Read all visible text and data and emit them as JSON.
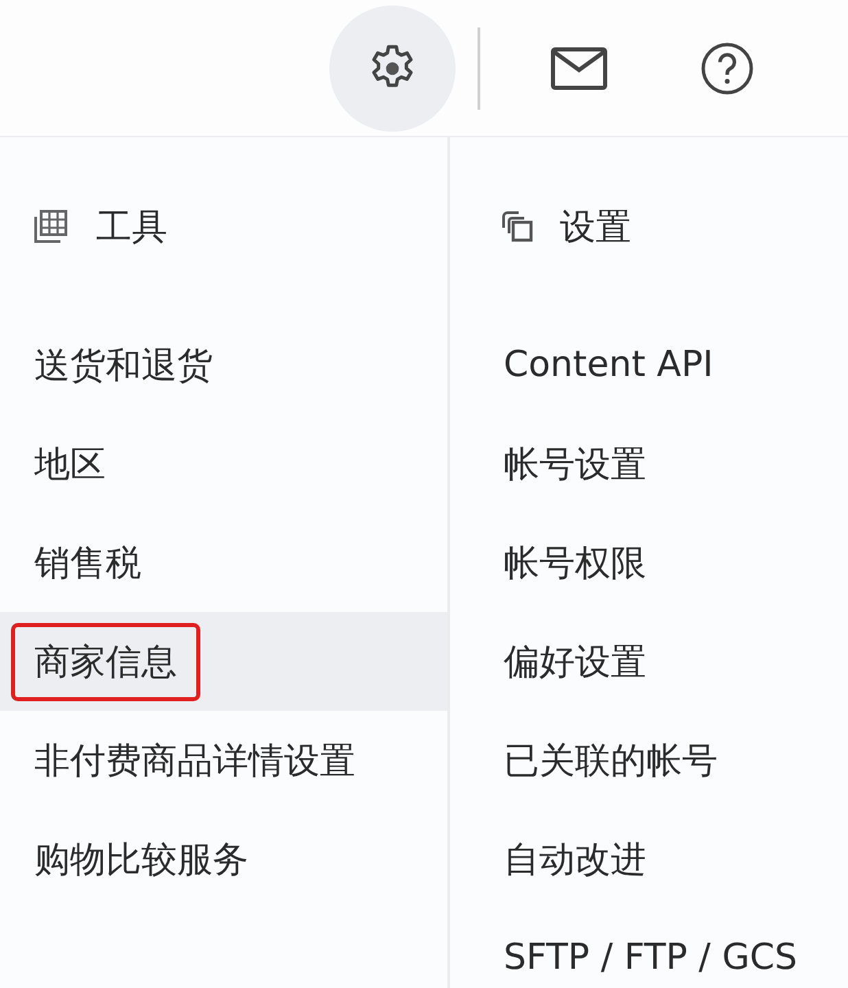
{
  "toolbar": {
    "buttons": [
      {
        "kind": "settings",
        "selected": true
      },
      {
        "kind": "mail",
        "selected": false
      },
      {
        "kind": "help",
        "selected": false
      }
    ]
  },
  "columns": [
    {
      "kind": "tools",
      "title": "工具",
      "items": [
        {
          "label": "送货和退货",
          "selected": false,
          "outlined": false
        },
        {
          "label": "地区",
          "selected": false,
          "outlined": false
        },
        {
          "label": "销售税",
          "selected": false,
          "outlined": false
        },
        {
          "label": "商家信息",
          "selected": true,
          "outlined": true
        },
        {
          "label": "非付费商品详情设置",
          "selected": false,
          "outlined": false
        },
        {
          "label": "购物比较服务",
          "selected": false,
          "outlined": false
        }
      ]
    },
    {
      "kind": "settings",
      "title": "设置",
      "items": [
        {
          "label": "Content API",
          "selected": false,
          "outlined": false
        },
        {
          "label": "帐号设置",
          "selected": false,
          "outlined": false
        },
        {
          "label": "帐号权限",
          "selected": false,
          "outlined": false
        },
        {
          "label": "偏好设置",
          "selected": false,
          "outlined": false
        },
        {
          "label": "已关联的帐号",
          "selected": false,
          "outlined": false
        },
        {
          "label": "自动改进",
          "selected": false,
          "outlined": false
        },
        {
          "label": "SFTP / FTP / GCS",
          "selected": false,
          "outlined": false
        }
      ]
    }
  ]
}
